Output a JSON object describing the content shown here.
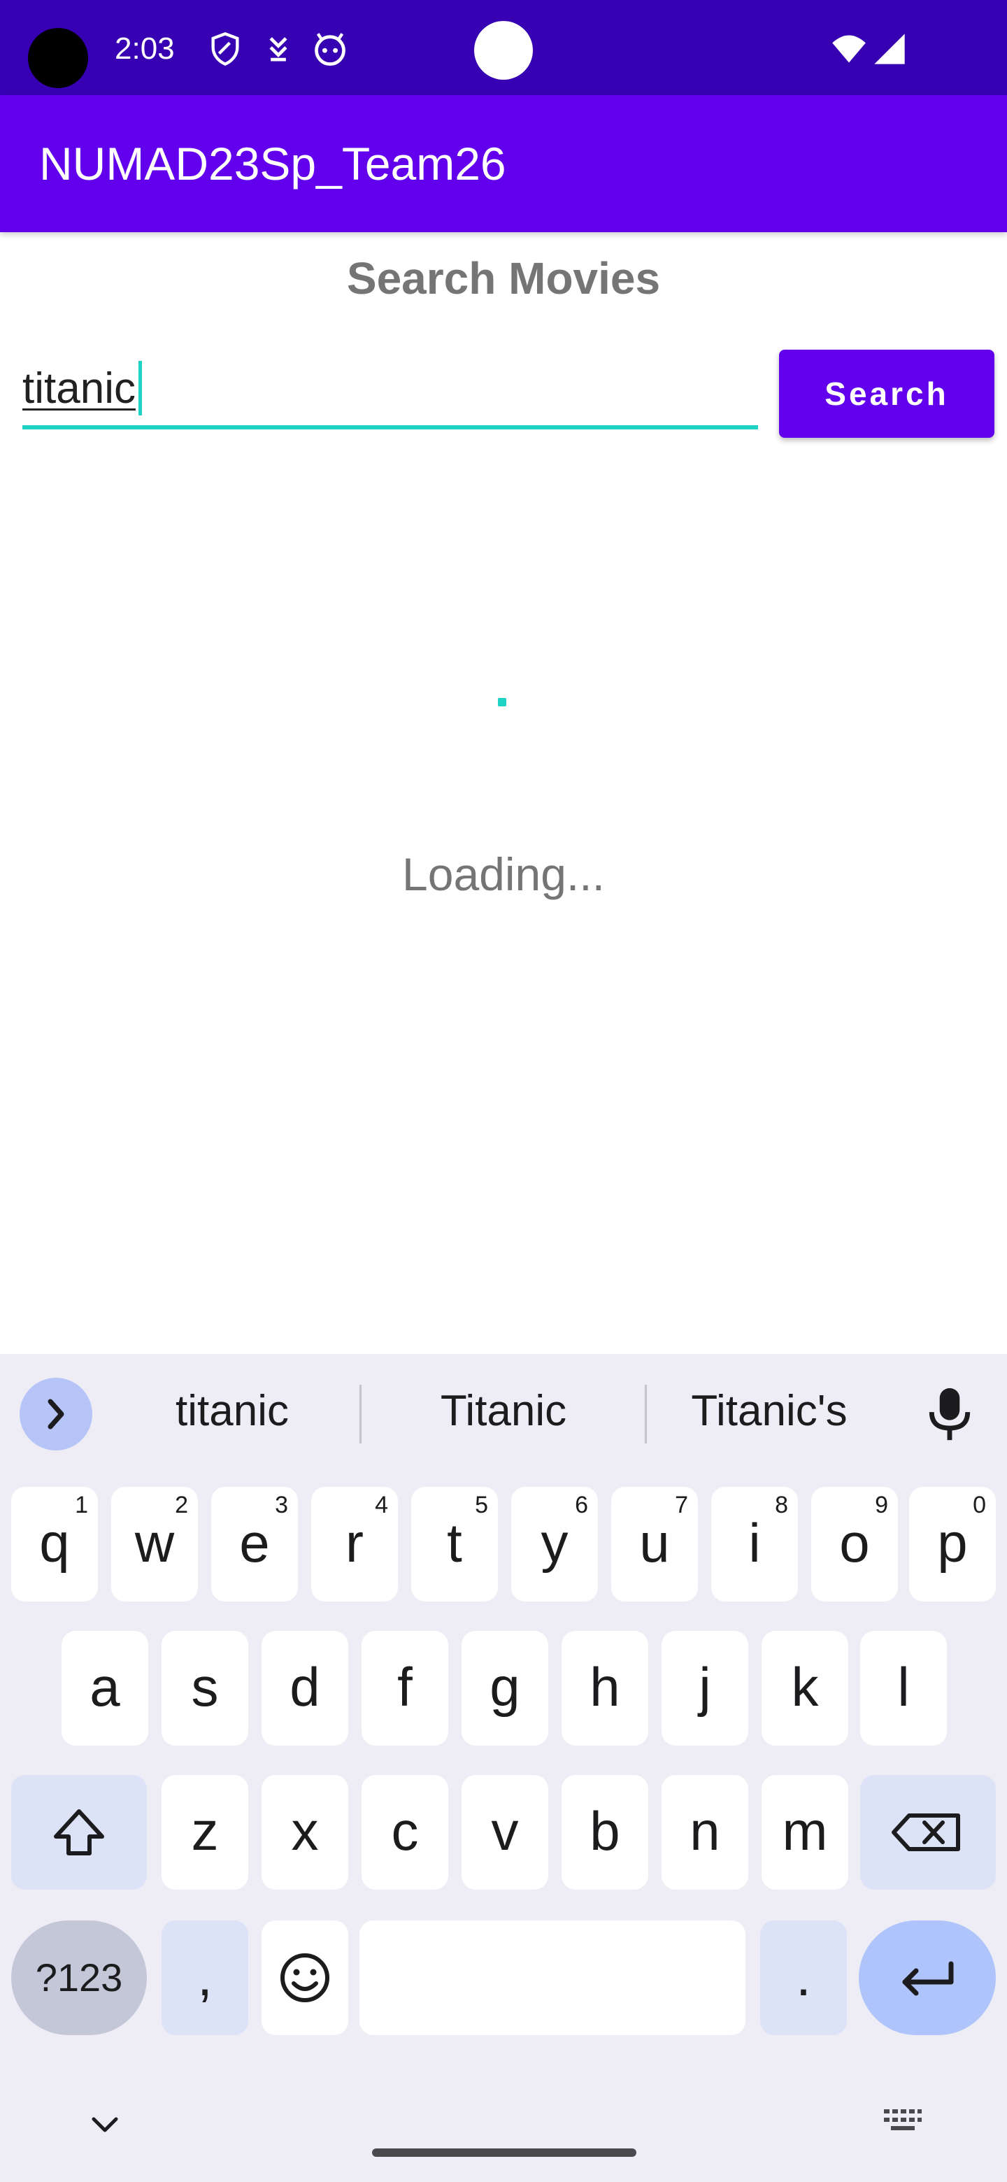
{
  "status_bar": {
    "time": "2:03",
    "icons": [
      "camera-cutout",
      "shield-icon",
      "download-icon",
      "android-face-icon",
      "wifi-icon",
      "signal-icon"
    ],
    "colors": {
      "background": "#3700b3"
    }
  },
  "app_bar": {
    "title": "NUMAD23Sp_Team26",
    "color": "#6200ee"
  },
  "main": {
    "heading": "Search Movies",
    "search_input": {
      "value": "titanic",
      "accent_color": "#1ed3c3"
    },
    "search_button": {
      "label": "Search"
    },
    "loading": {
      "text": "Loading..."
    }
  },
  "keyboard": {
    "suggestions": [
      "titanic",
      "Titanic",
      "Titanic's"
    ],
    "row1": [
      {
        "key": "q",
        "hint": "1"
      },
      {
        "key": "w",
        "hint": "2"
      },
      {
        "key": "e",
        "hint": "3"
      },
      {
        "key": "r",
        "hint": "4"
      },
      {
        "key": "t",
        "hint": "5"
      },
      {
        "key": "y",
        "hint": "6"
      },
      {
        "key": "u",
        "hint": "7"
      },
      {
        "key": "i",
        "hint": "8"
      },
      {
        "key": "o",
        "hint": "9"
      },
      {
        "key": "p",
        "hint": "0"
      }
    ],
    "row2": [
      "a",
      "s",
      "d",
      "f",
      "g",
      "h",
      "j",
      "k",
      "l"
    ],
    "row3": [
      "z",
      "x",
      "c",
      "v",
      "b",
      "n",
      "m"
    ],
    "bottom": {
      "symbols": "?123",
      "comma": ",",
      "period": "."
    },
    "icons": [
      "chevron-right-icon",
      "mic-icon",
      "shift-icon",
      "backspace-icon",
      "emoji-icon",
      "enter-icon",
      "chevron-down-icon",
      "keyboard-icon"
    ]
  }
}
